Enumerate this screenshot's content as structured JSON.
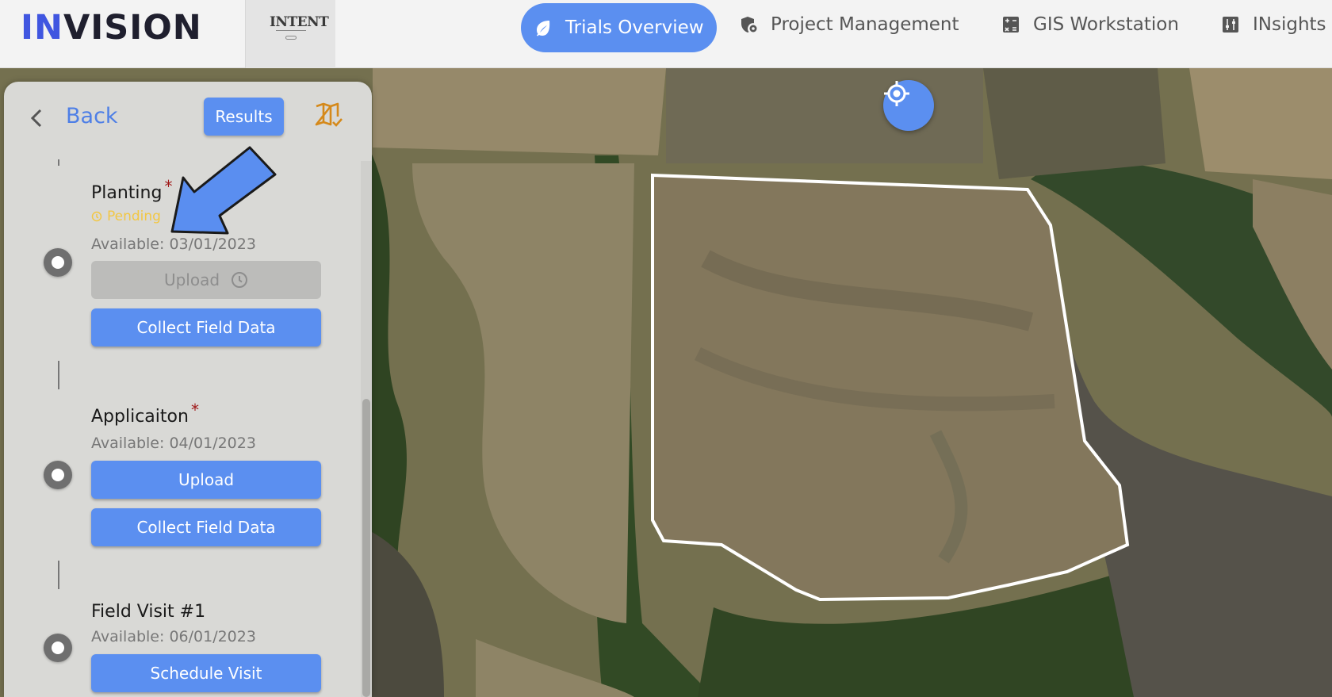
{
  "header": {
    "logo_in": "IN",
    "logo_rest": "VISION",
    "brand_mark": "INTENT",
    "nav": [
      {
        "label": "Trials Overview",
        "icon": "leaf-icon",
        "active": true
      },
      {
        "label": "Project Management",
        "icon": "shield-gear-icon",
        "active": false
      },
      {
        "label": "GIS Workstation",
        "icon": "calculator-icon",
        "active": false
      },
      {
        "label": "INsights",
        "icon": "sliders-icon",
        "active": false
      }
    ]
  },
  "panel": {
    "back_label": "Back",
    "results_label": "Results",
    "map_icon": "map-check-icon",
    "steps": [
      {
        "title": "Planting",
        "required_mark": "*",
        "status": "Pending",
        "available": "Available: 03/01/2023",
        "buttons": [
          "Upload",
          "Collect Field Data"
        ]
      },
      {
        "title": "Applicaiton",
        "required_mark": "*",
        "available": "Available: 04/01/2023",
        "buttons": [
          "Upload",
          "Collect Field Data"
        ]
      },
      {
        "title": "Field Visit #1",
        "available": "Available: 06/01/2023",
        "buttons": [
          "Schedule Visit"
        ]
      }
    ]
  },
  "map": {
    "locate_icon": "crosshair-icon",
    "boundary_color": "#ffffff",
    "accent_color": "#5b8ff0"
  }
}
